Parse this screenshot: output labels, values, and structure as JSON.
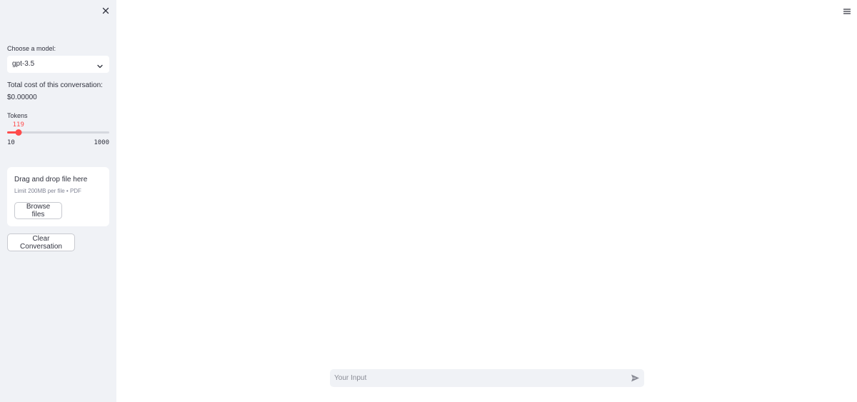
{
  "sidebar": {
    "close_icon": "close-icon",
    "model_label": "Choose a model:",
    "model_selected": "gpt-3.5",
    "cost_label": "Total cost of this conversation:",
    "cost_value": "$0.00000",
    "tokens": {
      "label": "Tokens",
      "value": 119,
      "value_text": "119",
      "min": 10,
      "min_text": "10",
      "max": 1000,
      "max_text": "1000"
    },
    "uploader": {
      "title": "Drag and drop file here",
      "limit": "Limit 200MB per file • PDF",
      "browse_label": "Browse files"
    },
    "clear_label": "Clear Conversation"
  },
  "main": {
    "menu_icon": "hamburger-menu-icon",
    "chat_input": {
      "placeholder": "Your Input",
      "value": "",
      "send_icon": "send-icon"
    }
  },
  "colors": {
    "accent": "#ff4b4b",
    "sidebar_bg": "#f0f2f6",
    "text": "#31333f"
  }
}
